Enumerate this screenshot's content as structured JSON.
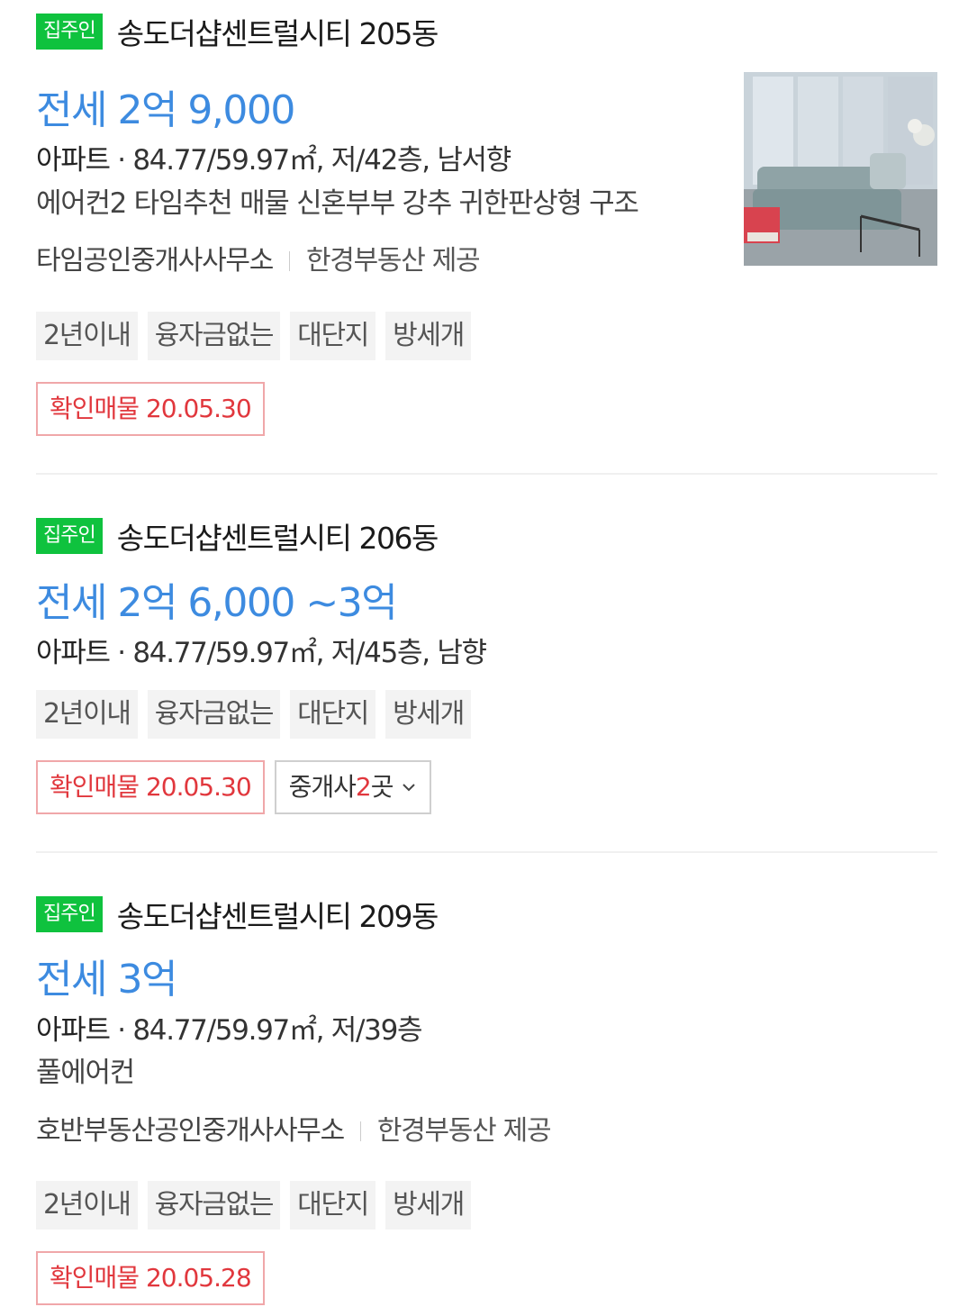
{
  "listings": [
    {
      "badge": "집주인",
      "complex": "송도더샵센트럴시티 205동",
      "price": "전세 2억 9,000",
      "type": "아파트",
      "spec": "· 84.77/59.97㎡, 저/42층, 남서향",
      "desc": "에어컨2 타임추천 매물 신혼부부 강추 귀한판상형 구조",
      "agency": "타임공인중개사사무소",
      "provider": "한경부동산 제공",
      "tags": [
        "2년이내",
        "융자금없는",
        "대단지",
        "방세개"
      ],
      "verified": "확인매물 20.05.30"
    },
    {
      "badge": "집주인",
      "complex": "송도더샵센트럴시티 206동",
      "price": "전세 2억 6,000 ~3억",
      "type": "아파트",
      "spec": "· 84.77/59.97㎡, 저/45층, 남향",
      "tags": [
        "2년이내",
        "융자금없는",
        "대단지",
        "방세개"
      ],
      "verified": "확인매물 20.05.30",
      "agents_prefix": "중개사 ",
      "agents_count": "2",
      "agents_suffix": "곳"
    },
    {
      "badge": "집주인",
      "complex": "송도더샵센트럴시티 209동",
      "price": "전세 3억",
      "type": "아파트",
      "spec": "· 84.77/59.97㎡, 저/39층",
      "desc": "풀에어컨",
      "agency": "호반부동산공인중개사사무소",
      "provider": "한경부동산 제공",
      "tags": [
        "2년이내",
        "융자금없는",
        "대단지",
        "방세개"
      ],
      "verified": "확인매물 20.05.28"
    }
  ],
  "colors": {
    "badge": "#0fc23e",
    "price": "#3d8be0",
    "verified": "#e1373d",
    "tag_bg": "#f3f3f3"
  },
  "icons": {
    "thumbnail": "living-room-photo",
    "agents_toggle": "chevron-down-icon"
  }
}
